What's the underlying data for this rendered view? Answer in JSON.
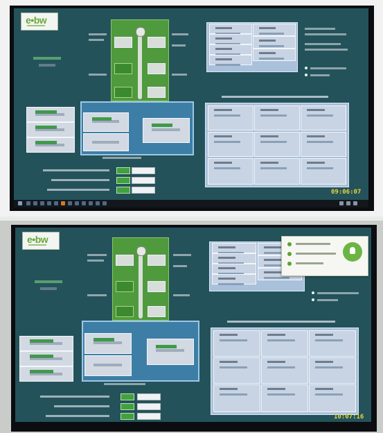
{
  "photos": [
    {
      "logo": "e•bw",
      "clock": "09:06:07"
    },
    {
      "logo": "e•bw",
      "clock": "10:07:16"
    }
  ],
  "colors": {
    "screen_bg": "#24525a",
    "tower_green": "#4f9a3c",
    "pool_blue": "#3d7ea6",
    "status_green": "#43a040",
    "clock_yellow": "#e6d33a",
    "logo_green": "#6aa83a"
  },
  "icons": {
    "start": "windows-start-icon",
    "notification": "app-notification-icon"
  }
}
